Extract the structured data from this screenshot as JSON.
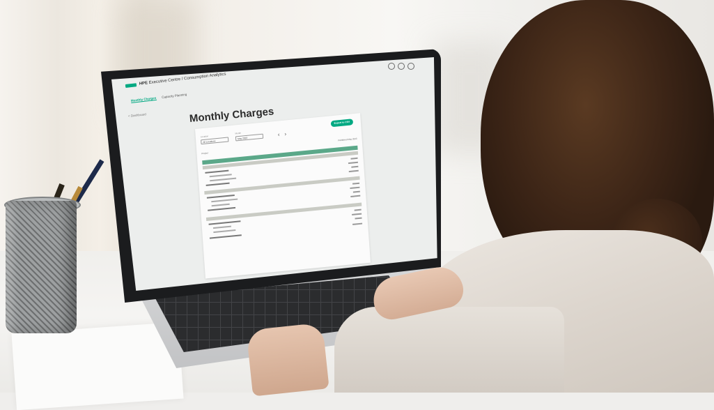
{
  "app": {
    "brand": "HPE",
    "title": "Executive Centre / Consumption Analytics",
    "nav_tabs": [
      "Monthly Charges",
      "Capacity Planning"
    ],
    "back_link": "< Dashboard",
    "header_icons": [
      "help-icon",
      "settings-icon",
      "user-icon"
    ]
  },
  "page": {
    "title": "Monthly Charges",
    "filters": [
      {
        "label": "Location",
        "value": "All Locations"
      },
      {
        "label": "Month",
        "value": "May 2023"
      }
    ],
    "export_label": "Export to CSV",
    "meta": {
      "project_label": "Project",
      "date_label": "Published May 2023"
    }
  },
  "colors": {
    "accent": "#01a982",
    "band_green": "#5ba889",
    "band_grey": "#c9cbc4"
  }
}
